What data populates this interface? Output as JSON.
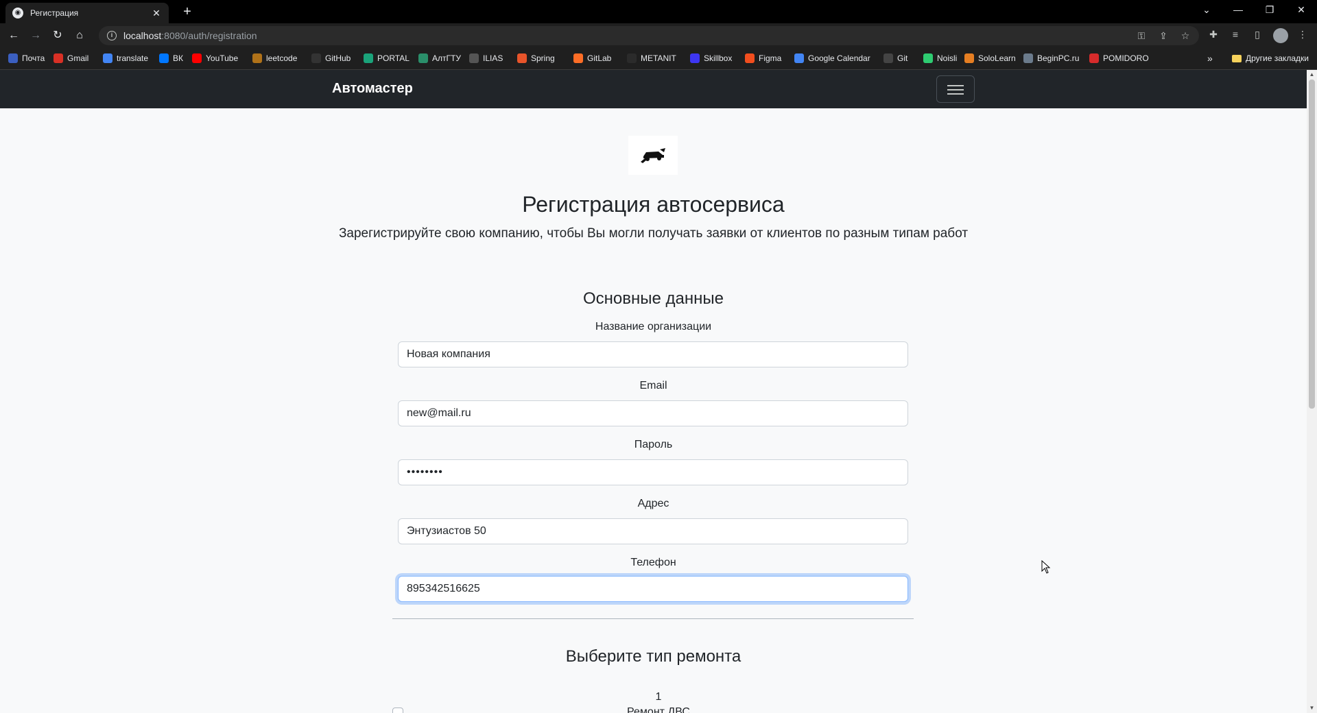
{
  "browser": {
    "tab_title": "Регистрация",
    "tab_close_glyph": "✕",
    "new_tab_glyph": "+",
    "url_host": "localhost",
    "url_path": ":8080/auth/registration",
    "bookmarks": [
      {
        "label": "Почта",
        "icon": "mail-icon",
        "color": "#3b5fc0"
      },
      {
        "label": "Gmail",
        "icon": "gmail-icon",
        "color": "#d93025"
      },
      {
        "label": "translate",
        "icon": "translate-icon",
        "color": "#4285f4"
      },
      {
        "label": "ВК",
        "icon": "vk-icon",
        "color": "#0077ff"
      },
      {
        "label": "YouTube",
        "icon": "youtube-icon",
        "color": "#ff0000"
      },
      {
        "label": "leetcode",
        "icon": "leetcode-icon",
        "color": "#b07219"
      },
      {
        "label": "GitHub",
        "icon": "github-icon",
        "color": "#333333"
      },
      {
        "label": "PORTAL",
        "icon": "portal-icon",
        "color": "#1aa37a"
      },
      {
        "label": "АлтГТУ",
        "icon": "altgtu-icon",
        "color": "#2a8f6a"
      },
      {
        "label": "ILIAS",
        "icon": "ilias-icon",
        "color": "#555555"
      },
      {
        "label": "Spring",
        "icon": "spring-icon",
        "color": "#e8542a"
      },
      {
        "label": "GitLab",
        "icon": "gitlab-icon",
        "color": "#fc6d26"
      },
      {
        "label": "METANIT",
        "icon": "metanit-icon",
        "color": "#2b2b2b"
      },
      {
        "label": "Skillbox",
        "icon": "skillbox-icon",
        "color": "#3d36f2"
      },
      {
        "label": "Figma",
        "icon": "figma-icon",
        "color": "#f24e1e"
      },
      {
        "label": "Google Calendar",
        "icon": "google-icon",
        "color": "#4285f4"
      },
      {
        "label": "Git",
        "icon": "git-icon",
        "color": "#444444"
      },
      {
        "label": "Noisli",
        "icon": "noisli-icon",
        "color": "#2ecc71"
      },
      {
        "label": "SoloLearn",
        "icon": "sololearn-icon",
        "color": "#e67e22"
      },
      {
        "label": "BeginPC.ru",
        "icon": "beginpc-icon",
        "color": "#6b7b8c"
      },
      {
        "label": "POMIDORO",
        "icon": "pomidoro-icon",
        "color": "#d62b2b"
      }
    ],
    "bookmarks_more": "»",
    "other_bookmarks": "Другие закладки"
  },
  "navbar": {
    "brand": "Автомастер"
  },
  "header": {
    "title": "Регистрация автосервиса",
    "lead": "Зарегистрируйте свою компанию, чтобы Вы могли получать заявки от клиентов по разным типам работ"
  },
  "basic": {
    "title": "Основные данные",
    "org_label": "Название организации",
    "org_value": "Новая компания",
    "email_label": "Email",
    "email_value": "new@mail.ru",
    "password_label": "Пароль",
    "password_value": "••••••••",
    "address_label": "Адрес",
    "address_value": "Энтузиастов 50",
    "phone_label": "Телефон",
    "phone_value": "895342516625"
  },
  "repair": {
    "title": "Выберите тип ремонта",
    "item_number": "1",
    "item_name": "Ремонт ДВС"
  },
  "colors": {
    "navbar_bg": "#212529",
    "page_bg": "#f8f9fa",
    "focus_ring": "#86b7fe"
  }
}
